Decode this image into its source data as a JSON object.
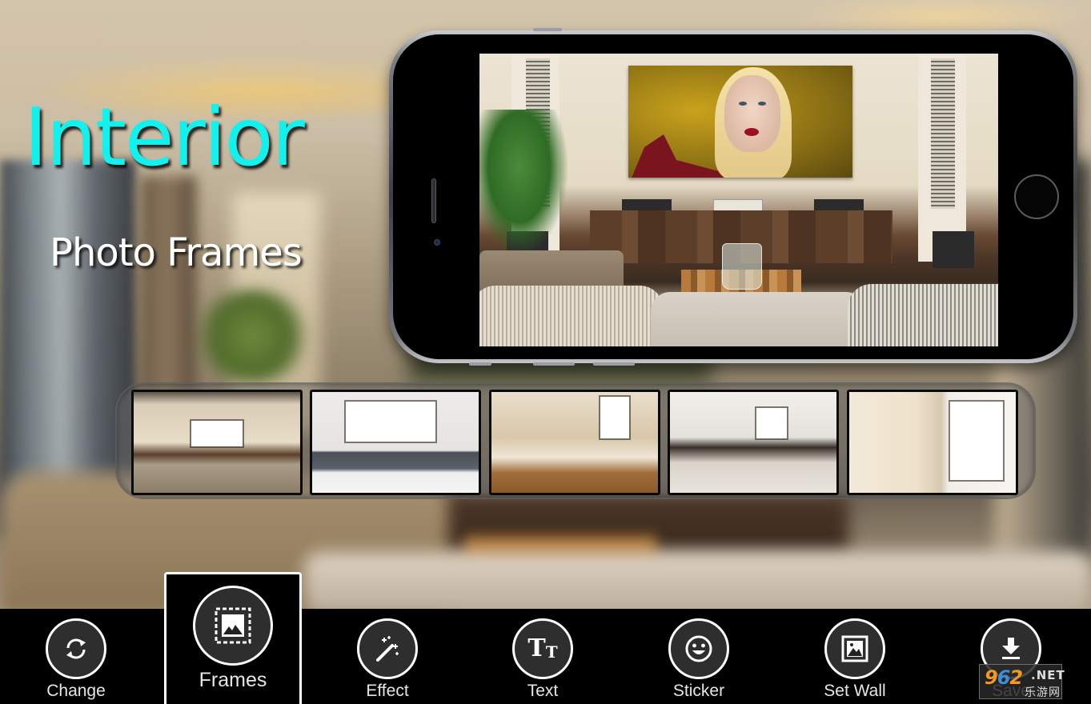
{
  "app": {
    "title_main": "Interior",
    "title_sub": "Photo Frames"
  },
  "colors": {
    "title_accent": "#11f2ef",
    "toolbar_bg": "#000000",
    "icon_circle_bg": "#2e2e2e",
    "icon_circle_border": "#ffffff"
  },
  "preview": {
    "description": "Living room frame with portrait photo placed in wall frame"
  },
  "frames_strip": {
    "items": [
      {
        "name": "living-room-tv-wall"
      },
      {
        "name": "white-wall-grey-sofa"
      },
      {
        "name": "bookshelf-living-room"
      },
      {
        "name": "fireplace-living-room"
      },
      {
        "name": "mall-lobby"
      }
    ]
  },
  "toolbar": {
    "items": [
      {
        "id": "change",
        "label": "Change",
        "icon": "refresh-icon",
        "selected": false
      },
      {
        "id": "frames",
        "label": "Frames",
        "icon": "frame-icon",
        "selected": true
      },
      {
        "id": "effect",
        "label": "Effect",
        "icon": "magic-wand-icon",
        "selected": false
      },
      {
        "id": "text",
        "label": "Text",
        "icon": "text-icon",
        "selected": false
      },
      {
        "id": "sticker",
        "label": "Sticker",
        "icon": "smiley-icon",
        "selected": false
      },
      {
        "id": "setwall",
        "label": "Set Wall",
        "icon": "wallpaper-icon",
        "selected": false
      },
      {
        "id": "save",
        "label": "Save",
        "icon": "download-icon",
        "selected": false
      }
    ]
  },
  "watermark": {
    "number": "962",
    "domain": ".NET",
    "chinese": "乐游网"
  }
}
